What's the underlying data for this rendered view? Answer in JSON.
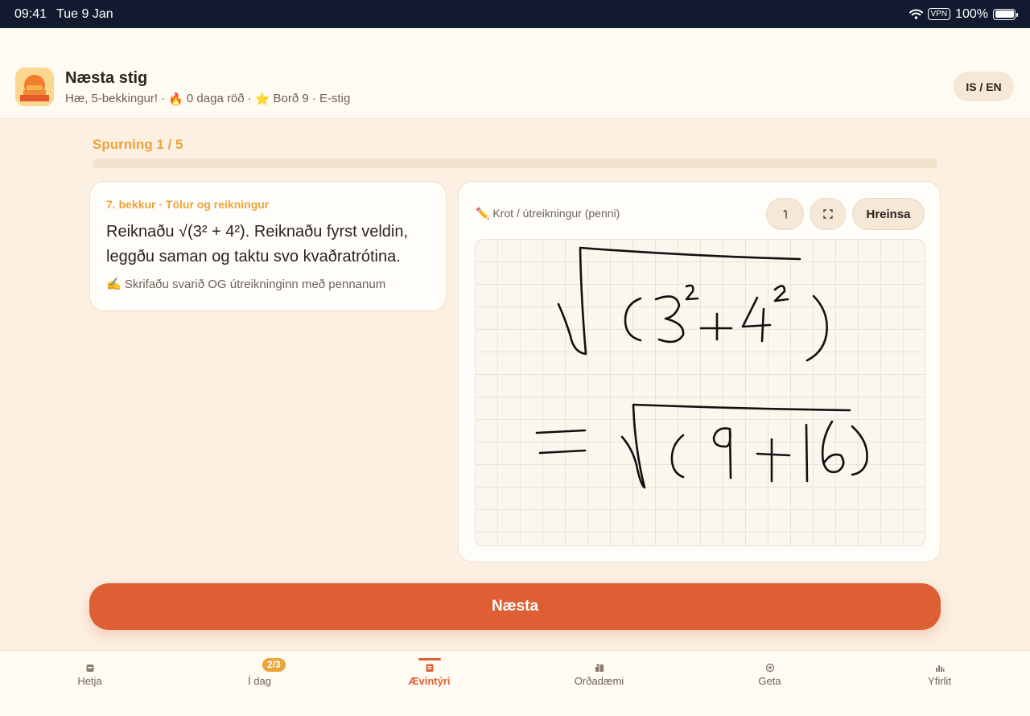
{
  "status_bar": {
    "time": "09:41",
    "date": "Tue 9 Jan",
    "vpn": "VPN",
    "battery": "100%"
  },
  "header": {
    "title": "Næsta stig",
    "greeting": "Hæ, 5-bekkingur! ·",
    "streak": "0 daga röð ·",
    "board": "Borð 9 · E-stig",
    "language_toggle": "IS / EN"
  },
  "progress": {
    "label": "Spurning 1 / 5",
    "fraction": 0.0
  },
  "question": {
    "topic": "7. bekkur · Tölur og reikningur",
    "text": "Reiknaðu √(3² + 4²). Reiknaðu fyrst veldin, leggðu saman og taktu svo kvaðratrótina.",
    "hint": "✍️ Skrifaðu svarið OG útreikninginn með pennanum"
  },
  "sketch": {
    "label": "✏️ Krot / útreikningur (penni)",
    "undo_icon": "undo-icon",
    "expand_icon": "expand-icon",
    "clear_label": "Hreinsa"
  },
  "next_button": "Næsta",
  "tabs": [
    {
      "label": "Hetja",
      "icon": "hero-icon"
    },
    {
      "label": "Í dag",
      "icon": "today-icon",
      "badge": "2/3"
    },
    {
      "label": "Ævintýri",
      "icon": "adventure-icon",
      "active": true
    },
    {
      "label": "Orðadæmi",
      "icon": "word-problems-icon"
    },
    {
      "label": "Geta",
      "icon": "ability-icon"
    },
    {
      "label": "Yfirlit",
      "icon": "overview-icon"
    }
  ],
  "colors": {
    "accent": "#dd5f33",
    "highlight": "#eba43a",
    "background": "#fbf0e2"
  }
}
